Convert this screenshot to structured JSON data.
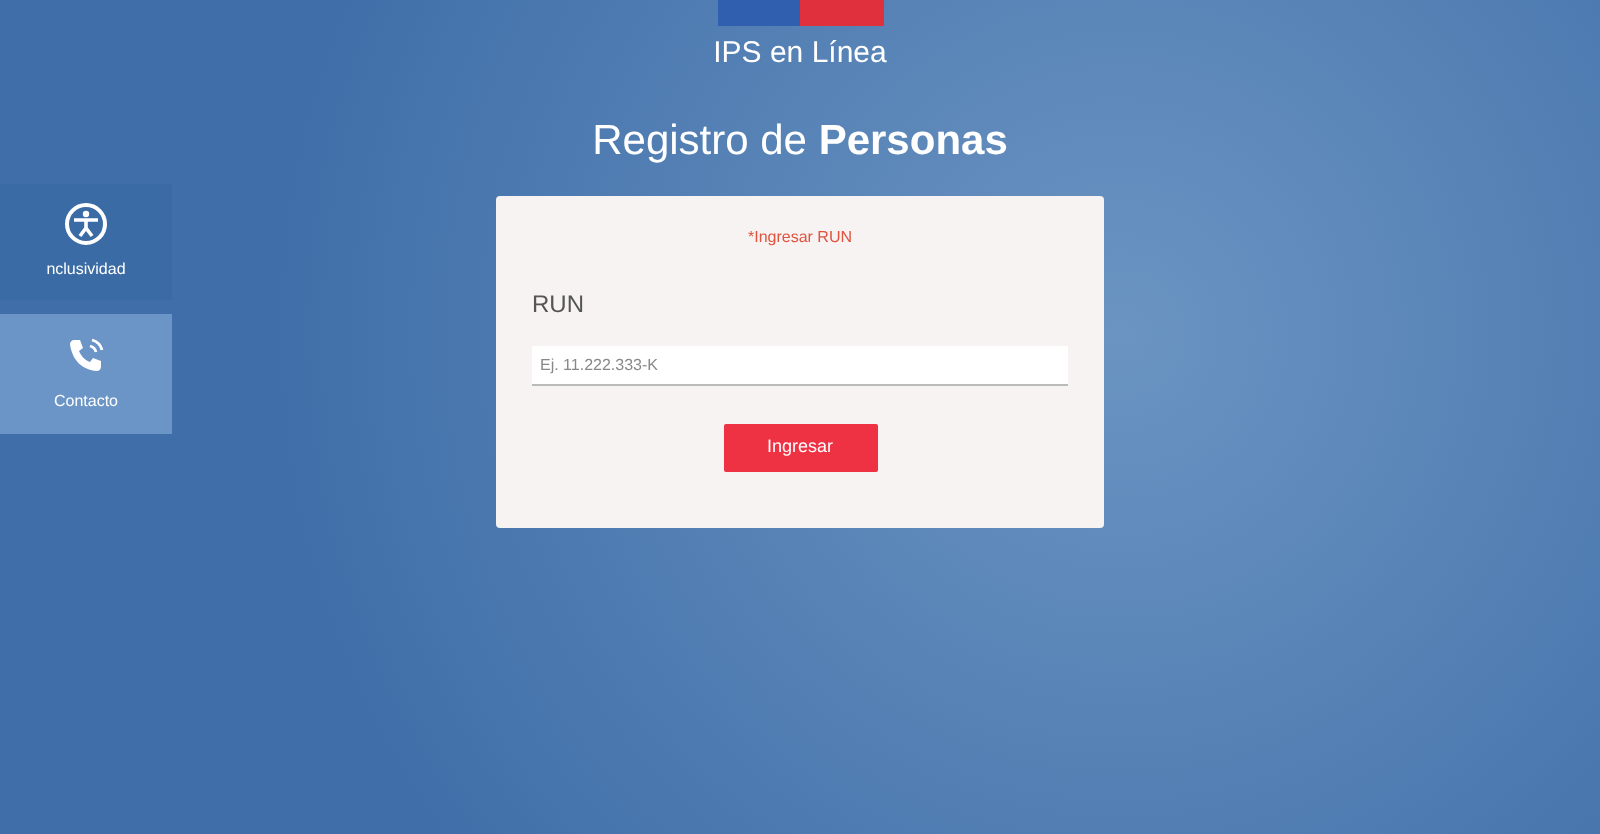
{
  "header": {
    "title": "IPS en Línea",
    "heading": "Registro de **Personas**"
  },
  "side_menu": [
    {
      "label": "nclusividad",
      "kind": "accessibility",
      "selected": false
    },
    {
      "label": "Contacto",
      "kind": "phone",
      "selected": true
    }
  ],
  "form": {
    "error": "*Ingresar RUN",
    "field_label": "RUN",
    "placeholder": "Ej. 11.222.333-K",
    "button": "Ingresar"
  }
}
